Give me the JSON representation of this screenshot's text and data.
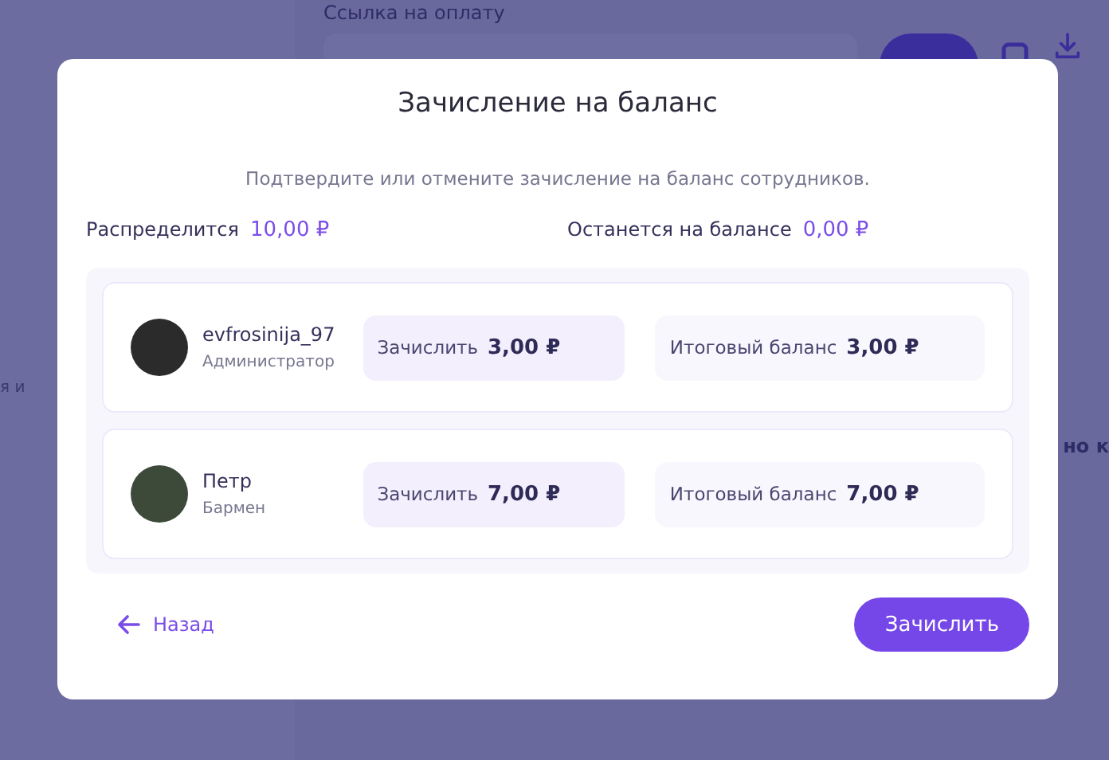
{
  "background": {
    "link_label": "Ссылка на оплату",
    "left_fragment": "я и",
    "right_fragment": "но к"
  },
  "modal": {
    "title": "Зачисление на баланс",
    "subtitle": "Подтвердите или отмените зачисление на баланс сотрудников.",
    "summary": [
      {
        "label": "Распределится",
        "value": "10,00 ₽"
      },
      {
        "label": "Останется на балансе",
        "value": "0,00 ₽"
      }
    ],
    "employees": [
      {
        "name": "evfrosinija_97",
        "role": "Администратор",
        "credit_label": "Зачислить",
        "credit": "3,00 ₽",
        "total_label": "Итоговый баланс",
        "total": "3,00 ₽",
        "color": "#2b2b2b"
      },
      {
        "name": "Петр",
        "role": "Бармен",
        "credit_label": "Зачислить",
        "credit": "7,00 ₽",
        "total_label": "Итоговый баланс",
        "total": "7,00 ₽",
        "color": "#3d4a3a"
      }
    ],
    "back": "Назад",
    "submit": "Зачислить"
  }
}
